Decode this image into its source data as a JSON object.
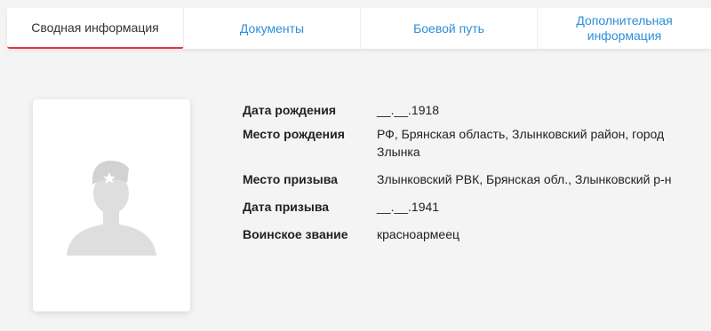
{
  "tabs": [
    {
      "label": "Сводная информация",
      "active": true
    },
    {
      "label": "Документы",
      "active": false
    },
    {
      "label": "Боевой путь",
      "active": false
    },
    {
      "label": "Дополнительная информация",
      "active": false
    }
  ],
  "colors": {
    "accent_red": "#e8323a",
    "link_blue": "#2a8fd8",
    "background": "#f4f4f4",
    "placeholder_gray": "#dedede"
  },
  "photo": {
    "icon": "soldier-silhouette-placeholder-icon"
  },
  "info": [
    {
      "label": "Дата рождения",
      "value": "__.__.1918"
    },
    {
      "label": "Место рождения",
      "value": "РФ, Брянская область, Злынковский район, город Злынка"
    },
    {
      "label": "Место призыва",
      "value": "Злынковский РВК, Брянская обл., Злынковский р-н"
    },
    {
      "label": "Дата призыва",
      "value": "__.__.1941"
    },
    {
      "label": "Воинское звание",
      "value": "красноармеец"
    }
  ]
}
